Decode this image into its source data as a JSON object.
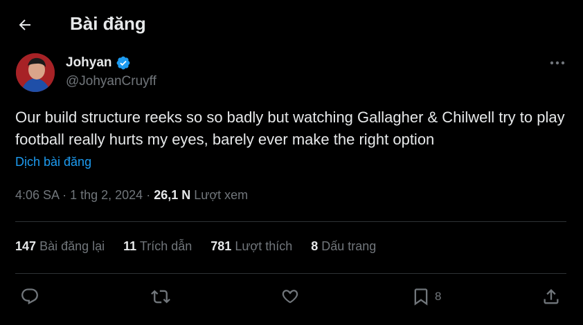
{
  "header": {
    "title": "Bài đăng",
    "back_icon": "arrow-left-icon"
  },
  "author": {
    "name": "Johyan",
    "handle": "@JohyanCruyff",
    "verified": true,
    "verified_color": "#1d9bf0"
  },
  "tweet": {
    "text": "Our build structure reeks so so badly but watching Gallagher & Chilwell try to play football really hurts my eyes, barely ever make the right option",
    "translate_label": "Dịch bài đăng"
  },
  "meta": {
    "time": "4:06 SA",
    "date": "1 thg 2, 2024",
    "views_count": "26,1 N",
    "views_label": "Lượt xem",
    "separator": "·"
  },
  "stats": [
    {
      "count": "147",
      "label": "Bài đăng lại"
    },
    {
      "count": "11",
      "label": "Trích dẫn"
    },
    {
      "count": "781",
      "label": "Lượt thích"
    },
    {
      "count": "8",
      "label": "Dấu trang"
    }
  ],
  "actions": {
    "reply_icon": "reply-icon",
    "repost_icon": "repost-icon",
    "like_icon": "heart-icon",
    "bookmark_icon": "bookmark-icon",
    "bookmark_count": "8",
    "share_icon": "share-icon"
  },
  "colors": {
    "background": "#000000",
    "text": "#e7e9ea",
    "secondary": "#71767b",
    "accent": "#1d9bf0",
    "divider": "#2f3336"
  }
}
